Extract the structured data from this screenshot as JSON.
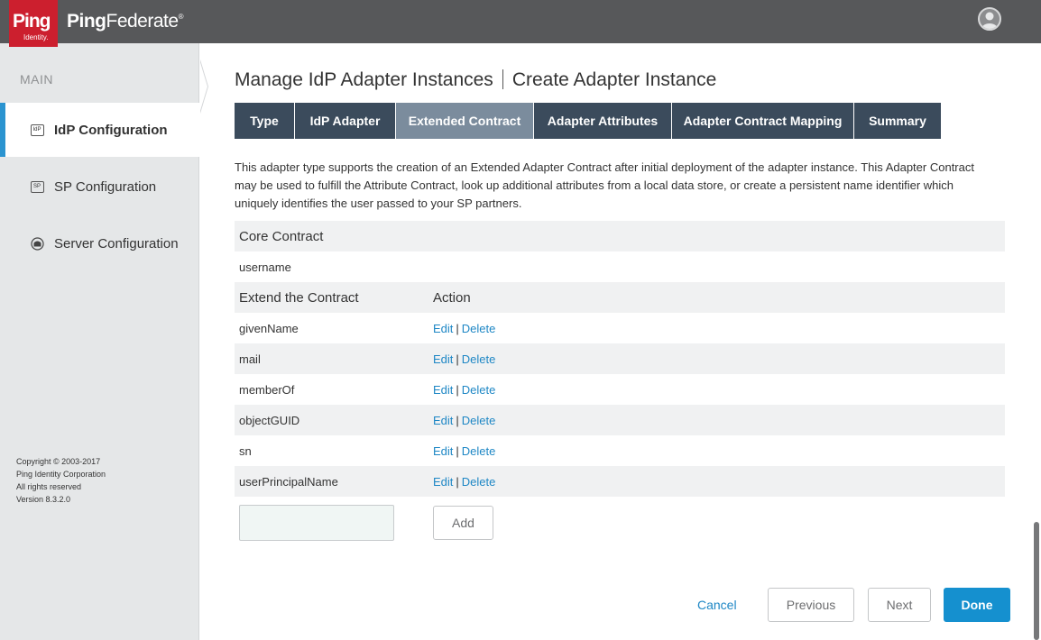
{
  "header": {
    "logo_text": "Ping",
    "logo_sub": "Identity.",
    "product_prefix": "Ping",
    "product_suffix": "Federate",
    "trademark": "®"
  },
  "sidebar": {
    "section_label": "MAIN",
    "items": [
      {
        "label": "IdP Configuration",
        "icon": "idp-icon",
        "icon_text": "IdP",
        "active": true
      },
      {
        "label": "SP Configuration",
        "icon": "sp-icon",
        "icon_text": "SP",
        "active": false
      },
      {
        "label": "Server Configuration",
        "icon": "server-icon",
        "active": false
      }
    ],
    "copyright": {
      "line1": "Copyright © 2003-2017",
      "line2": "Ping Identity Corporation",
      "line3": "All rights reserved",
      "line4": "Version 8.3.2.0"
    }
  },
  "main": {
    "title": "Manage IdP Adapter Instances",
    "subtitle": "Create Adapter Instance",
    "tabs": [
      {
        "label": "Type",
        "active": false
      },
      {
        "label": "IdP Adapter",
        "active": false
      },
      {
        "label": "Extended Contract",
        "active": true
      },
      {
        "label": "Adapter Attributes",
        "active": false
      },
      {
        "label": "Adapter Contract Mapping",
        "active": false
      },
      {
        "label": "Summary",
        "active": false
      }
    ],
    "description": "This adapter type supports the creation of an Extended Adapter Contract after initial deployment of the adapter instance. This Adapter Contract may be used to fulfill the Attribute Contract, look up additional attributes from a local data store, or create a persistent name identifier which uniquely identifies the user passed to your SP partners.",
    "core_contract_header": "Core Contract",
    "core_contract_value": "username",
    "extend_header": "Extend the Contract",
    "action_header": "Action",
    "edit_label": "Edit",
    "delete_label": "Delete",
    "separator": "|",
    "attributes": [
      "givenName",
      "mail",
      "memberOf",
      "objectGUID",
      "sn",
      "userPrincipalName"
    ],
    "new_attribute_value": "",
    "add_label": "Add",
    "cancel_label": "Cancel",
    "previous_label": "Previous",
    "next_label": "Next",
    "done_label": "Done"
  },
  "colors": {
    "header_bg": "#57585a",
    "brand_red": "#cc1f2e",
    "tab_bg": "#3b4b5c",
    "tab_active_bg": "#7b8c9d",
    "link": "#1e87c5",
    "primary_button": "#1590cf",
    "sidebar_accent": "#2b94d0"
  }
}
